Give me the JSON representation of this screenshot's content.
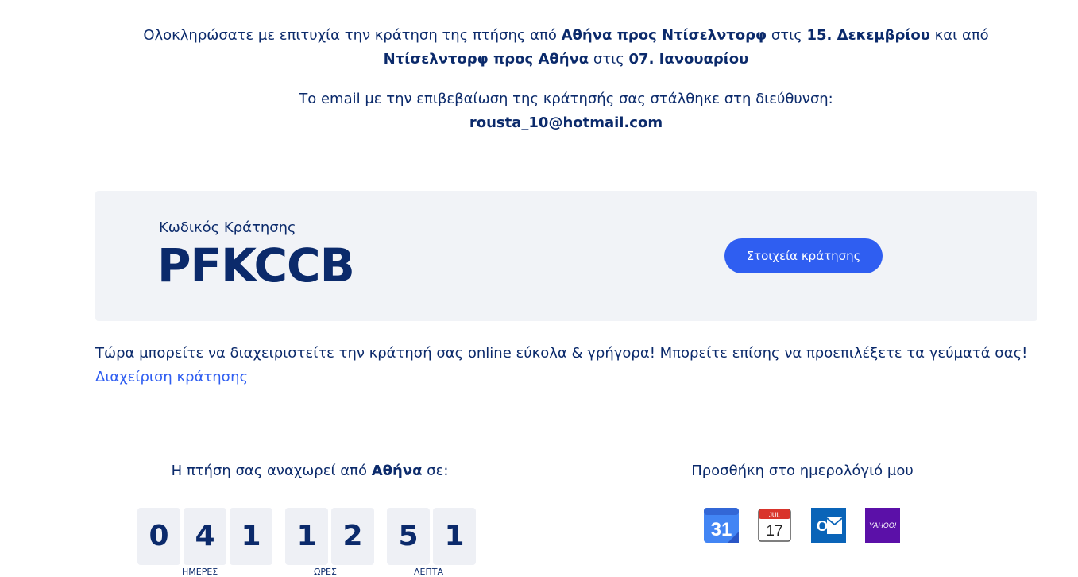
{
  "confirmation": {
    "prefix": "Ολοκληρώσατε με επιτυχία την κράτηση της πτήσης από ",
    "outbound_route": "Αθήνα προς Ντίσελντορφ",
    "on1": " στις ",
    "outbound_date": "15. Δεκεμβρίου",
    "and_from": " και από ",
    "return_route": "Ντίσελντορφ προς Αθήνα",
    "on2": " στις ",
    "return_date": "07. Ιανουαρίου"
  },
  "email_notice": {
    "text": "Το email με την επιβεβαίωση της κράτησής σας στάλθηκε στη διεύθυνση:",
    "address": "rousta_10@hotmail.com"
  },
  "booking": {
    "label": "Κωδικός Κράτησης",
    "code": "PFKCCB",
    "details_button": "Στοιχεία κράτησης"
  },
  "manage": {
    "text": "Τώρα μπορείτε να διαχειριστείτε την κράτησή σας online εύκολα & γρήγορα! Μπορείτε επίσης να προεπιλέξετε τα γεύματά σας!",
    "link": "Διαχείριση κράτησης"
  },
  "departure": {
    "prefix": "Η πτήση σας αναχωρεί από ",
    "city": "Αθήνα",
    "suffix": " σε:",
    "digits": [
      "0",
      "4",
      "1",
      "1",
      "2",
      "5",
      "1"
    ],
    "units": [
      "ΗΜΕΡΕΣ",
      "ΩΡΕΣ",
      "ΛΕΠΤΑ"
    ]
  },
  "calendar": {
    "title": "Προσθήκη στο ημερολόγιό μου",
    "icons": [
      "google-calendar-icon",
      "apple-calendar-icon",
      "outlook-icon",
      "yahoo-icon"
    ],
    "google_day": "31",
    "apple_month": "JUL",
    "apple_day": "17",
    "outlook_letter": "O",
    "yahoo_text": "YAHOO!"
  },
  "colors": {
    "text": "#0b2a6b",
    "accent": "#2f5ef1",
    "panel": "#f1f3f7"
  }
}
